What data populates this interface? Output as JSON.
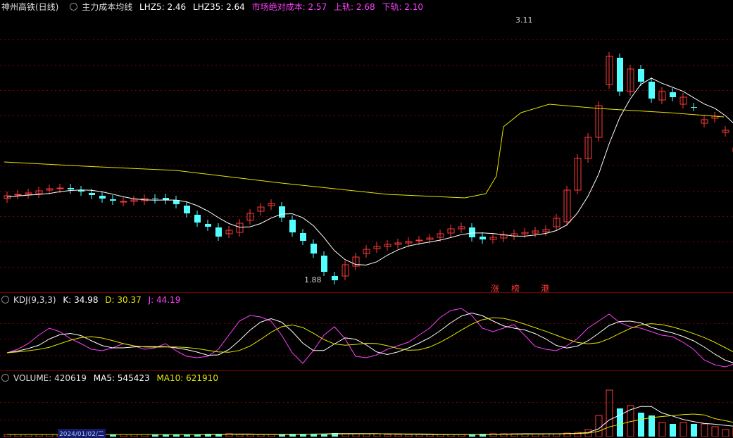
{
  "main": {
    "title": "神州高铁(日线)",
    "indicator": "主力成本均线",
    "lhz5": "LHZ5: 2.46",
    "lhz35": "LHZ35: 2.64",
    "market_cost": "市场绝对成本: 2.57",
    "upper": "上轨: 2.68",
    "lower": "下轨: 2.10",
    "high_label": "3.11",
    "low_label": "1.88",
    "tags": [
      "涨",
      "榜",
      "港"
    ]
  },
  "kdj": {
    "title": "KDJ(9,3,3)",
    "k": "K: 34.98",
    "d": "D: 30.37",
    "j": "J: 44.19"
  },
  "volume": {
    "title": "VOLUME: 420619",
    "ma5": "MA5: 545423",
    "ma10": "MA10: 621910"
  },
  "axis": {
    "date": "2024/01/02/二"
  },
  "colors": {
    "up": "#ff3a3a",
    "down": "#54ffff",
    "lhz5": "#ffffff",
    "lhz35": "#e6e600",
    "market": "#ff40ff",
    "grid": "#7a0000"
  }
}
